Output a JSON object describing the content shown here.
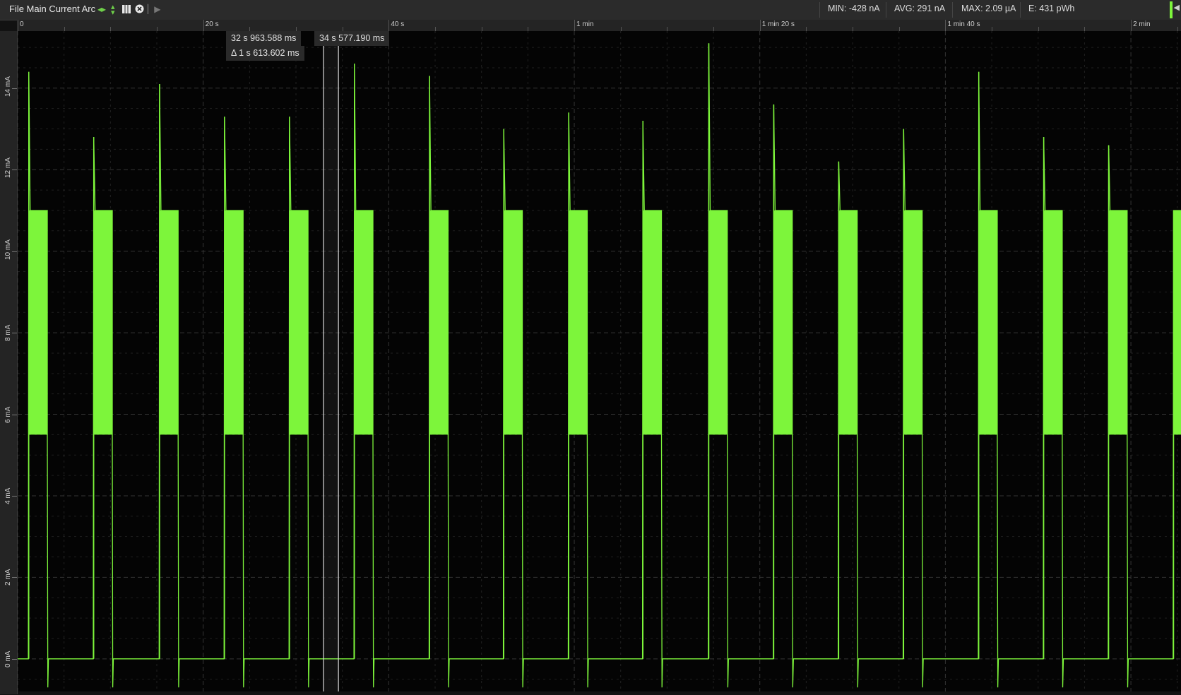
{
  "header": {
    "title": "File Main Current Arc",
    "icons": [
      "pan-horizontal-icon",
      "pan-vertical-icon",
      "grid-icon",
      "close-circle-icon",
      "skip-forward-icon"
    ],
    "stats": {
      "min": "MIN: -428 nA",
      "avg": "AVG: 291 nA",
      "max": "MAX: 2.09 µA",
      "energy": "E: 431 pWh"
    }
  },
  "cursors": {
    "a_time": "32 s 963.588 ms",
    "delta": "Δ 1 s 613.602 ms",
    "b_time": "34 s 577.190 ms"
  },
  "colors": {
    "trace": "#7df53b",
    "background": "#040404",
    "grid": "#3a3a3a",
    "cursor": "#d8d8d8"
  },
  "chart_data": {
    "type": "line",
    "title": "",
    "xlabel": "",
    "ylabel": "",
    "x_unit": "s",
    "xlim": [
      0,
      125.4
    ],
    "ylim": [
      -0.8,
      15.4
    ],
    "x_ticks": [
      0,
      20,
      40,
      60,
      80,
      100,
      120
    ],
    "x_tick_labels": [
      "0",
      "20 s",
      "40 s",
      "1 min",
      "1 min 20 s",
      "1 min 40 s",
      "2 min"
    ],
    "y_ticks": [
      0,
      2,
      4,
      6,
      8,
      10,
      12,
      14
    ],
    "y_tick_labels": [
      "0 mA",
      "2 mA",
      "4 mA",
      "6 mA",
      "8 mA",
      "10 mA",
      "12 mA",
      "14 mA"
    ],
    "grid": true,
    "baseline_mA": 0,
    "burst_low_mA": 5.5,
    "burst_high_mA": 11,
    "bursts": [
      {
        "start_s": 1.2,
        "end_s": 3.2,
        "peak_mA": 14.4
      },
      {
        "start_s": 8.2,
        "end_s": 10.2,
        "peak_mA": 12.8
      },
      {
        "start_s": 15.3,
        "end_s": 17.3,
        "peak_mA": 14.1
      },
      {
        "start_s": 22.3,
        "end_s": 24.3,
        "peak_mA": 13.3
      },
      {
        "start_s": 29.3,
        "end_s": 31.3,
        "peak_mA": 13.3
      },
      {
        "start_s": 36.3,
        "end_s": 38.3,
        "peak_mA": 14.6
      },
      {
        "start_s": 44.4,
        "end_s": 46.4,
        "peak_mA": 14.3
      },
      {
        "start_s": 52.4,
        "end_s": 54.4,
        "peak_mA": 13.0
      },
      {
        "start_s": 59.4,
        "end_s": 61.4,
        "peak_mA": 13.4
      },
      {
        "start_s": 67.4,
        "end_s": 69.4,
        "peak_mA": 13.2
      },
      {
        "start_s": 74.5,
        "end_s": 76.5,
        "peak_mA": 15.1
      },
      {
        "start_s": 81.5,
        "end_s": 83.5,
        "peak_mA": 13.6
      },
      {
        "start_s": 88.5,
        "end_s": 90.5,
        "peak_mA": 12.2
      },
      {
        "start_s": 95.5,
        "end_s": 97.5,
        "peak_mA": 13.0
      },
      {
        "start_s": 103.6,
        "end_s": 105.6,
        "peak_mA": 14.4
      },
      {
        "start_s": 110.6,
        "end_s": 112.6,
        "peak_mA": 12.8
      },
      {
        "start_s": 117.6,
        "end_s": 119.6,
        "peak_mA": 12.6
      },
      {
        "start_s": 124.6,
        "end_s": 125.4,
        "peak_mA": 11.0
      }
    ],
    "cursor_a_s": 32.963588,
    "cursor_b_s": 34.57719
  }
}
